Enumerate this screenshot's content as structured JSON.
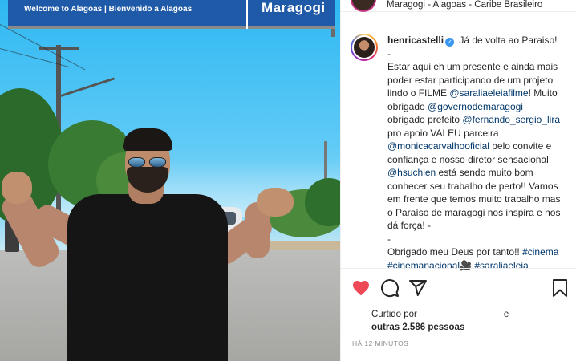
{
  "photo": {
    "sign_left_text": "Welcome to Alagoas | Bienvenido a Alagoas",
    "sign_right_text": "Maragogi"
  },
  "post": {
    "location": "Maragogi - Alagoas - Caribe Brasileiro",
    "username": "henricastelli",
    "verified": true,
    "caption_lines": [
      [
        {
          "t": "Já de volta ao Paraiso!",
          "m": false
        }
      ],
      [
        {
          "t": "-",
          "m": false
        }
      ],
      [
        {
          "t": "Estar aqui eh um presente e ainda mais",
          "m": false
        }
      ],
      [
        {
          "t": "poder estar participando de um projeto",
          "m": false
        }
      ],
      [
        {
          "t": "lindo o FILME ",
          "m": false
        },
        {
          "t": "@saraliaeleiafilme",
          "m": true
        },
        {
          "t": "! Muito",
          "m": false
        }
      ],
      [
        {
          "t": "obrigado ",
          "m": false
        },
        {
          "t": "@governodemaragogi",
          "m": true
        }
      ],
      [
        {
          "t": "obrigado prefeito ",
          "m": false
        },
        {
          "t": "@fernando_sergio_lira",
          "m": true
        }
      ],
      [
        {
          "t": "pro apoio VALEU parceira",
          "m": false
        }
      ],
      [
        {
          "t": "@monicacarvalhooficial",
          "m": true
        },
        {
          "t": " pelo convite e",
          "m": false
        }
      ],
      [
        {
          "t": "confiança e nosso diretor sensacional",
          "m": false
        }
      ],
      [
        {
          "t": "@hsuchien",
          "m": true
        },
        {
          "t": " está sendo muito bom",
          "m": false
        }
      ],
      [
        {
          "t": "conhecer seu trabalho de perto!! Vamos",
          "m": false
        }
      ],
      [
        {
          "t": "em frente que temos muito trabalho mas",
          "m": false
        }
      ],
      [
        {
          "t": "o Paraíso de maragogi nos inspira e nos",
          "m": false
        }
      ],
      [
        {
          "t": "dá força! -",
          "m": false
        }
      ],
      [
        {
          "t": "-",
          "m": false
        }
      ],
      [
        {
          "t": "Obrigado meu Deus por tanto!! ",
          "m": false
        },
        {
          "t": "#cinema",
          "m": true
        }
      ],
      [
        {
          "t": "#cinemanacional",
          "m": true
        },
        {
          "t": "🎥 ",
          "m": false
        },
        {
          "t": "#saraliaeleia",
          "m": true
        }
      ]
    ],
    "likes_prefix": "Curtido por",
    "likes_connector": "e",
    "likes_others": "outras 2.586 pessoas",
    "time_ago": "HÁ 12 MINUTOS"
  },
  "icons": {
    "like": "heart-icon",
    "comment": "comment-icon",
    "share": "share-icon",
    "save": "bookmark-icon"
  },
  "colors": {
    "like_red": "#ed4956",
    "mention_blue": "#00376b",
    "verified_blue": "#3897f0"
  }
}
